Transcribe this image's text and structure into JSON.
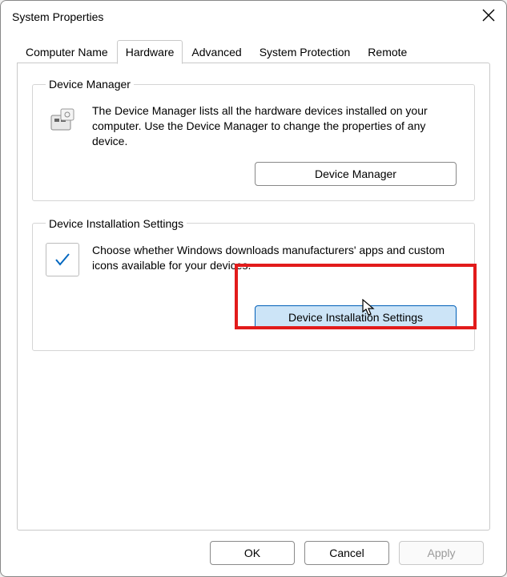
{
  "window": {
    "title": "System Properties"
  },
  "tabs": [
    {
      "label": "Computer Name"
    },
    {
      "label": "Hardware"
    },
    {
      "label": "Advanced"
    },
    {
      "label": "System Protection"
    },
    {
      "label": "Remote"
    }
  ],
  "device_manager": {
    "legend": "Device Manager",
    "description": "The Device Manager lists all the hardware devices installed on your computer. Use the Device Manager to change the properties of any device.",
    "button": "Device Manager"
  },
  "device_install": {
    "legend": "Device Installation Settings",
    "description": "Choose whether Windows downloads manufacturers' apps and custom icons available for your devices.",
    "button": "Device Installation Settings"
  },
  "footer": {
    "ok": "OK",
    "cancel": "Cancel",
    "apply": "Apply"
  }
}
